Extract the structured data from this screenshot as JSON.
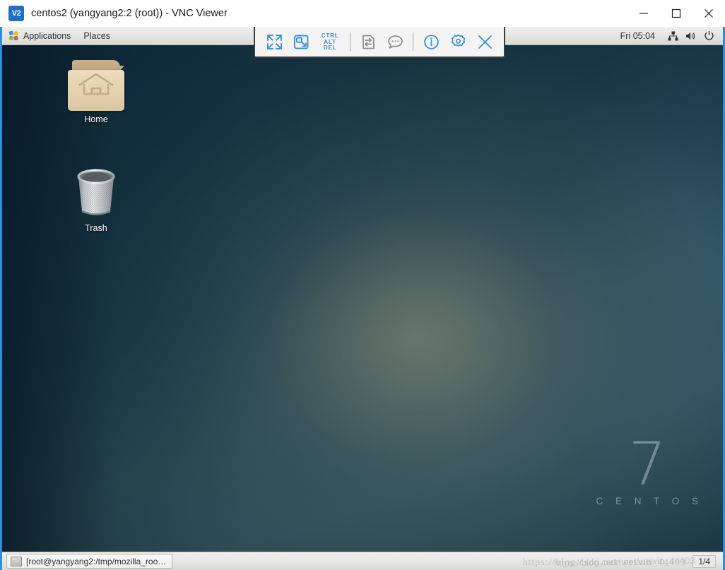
{
  "window": {
    "title": "centos2 (yangyang2:2 (root)) - VNC Viewer",
    "logo_text": "V2",
    "controls": {
      "minimize": "minimize",
      "maximize": "maximize",
      "close": "close"
    }
  },
  "vnc_toolbar": {
    "buttons": [
      {
        "name": "fullscreen",
        "label": "Full screen"
      },
      {
        "name": "windowed",
        "label": "Windowed"
      },
      {
        "name": "ctrl-alt-del",
        "label": "CTRL ALT DEL",
        "line1": "CTRL",
        "line2": "ALT",
        "line3": "DEL"
      },
      {
        "name": "file-transfer",
        "label": "File transfer",
        "enabled": false
      },
      {
        "name": "chat",
        "label": "Chat",
        "enabled": false
      },
      {
        "name": "info",
        "label": "Connection info"
      },
      {
        "name": "options",
        "label": "Options"
      },
      {
        "name": "disconnect",
        "label": "Disconnect"
      }
    ],
    "accent_color": "#3c8fe0",
    "disabled_color": "#8e8e8e"
  },
  "gnome_panel": {
    "menus": [
      {
        "label": "Applications",
        "icon": "applications-icon"
      },
      {
        "label": "Places",
        "icon": "places-icon"
      }
    ],
    "clock": "Fri 05:04",
    "tray": [
      {
        "name": "network-icon",
        "label": "Network"
      },
      {
        "name": "volume-icon",
        "label": "Volume"
      },
      {
        "name": "power-icon",
        "label": "Power"
      }
    ]
  },
  "desktop": {
    "icons": [
      {
        "name": "home",
        "label": "Home"
      },
      {
        "name": "trash",
        "label": "Trash"
      }
    ],
    "branding": {
      "version": "7",
      "name": "C E N T O S"
    }
  },
  "taskbar": {
    "windows": [
      {
        "label": "[root@yangyang2:/tmp/mozilla_roo…",
        "icon": "terminal-icon"
      }
    ],
    "workspace": "1/4"
  },
  "watermark": {
    "text": "https://blog.csdn.net/weixin_44403",
    "text2": "https://blog.csdn.net/weixin_44403"
  }
}
